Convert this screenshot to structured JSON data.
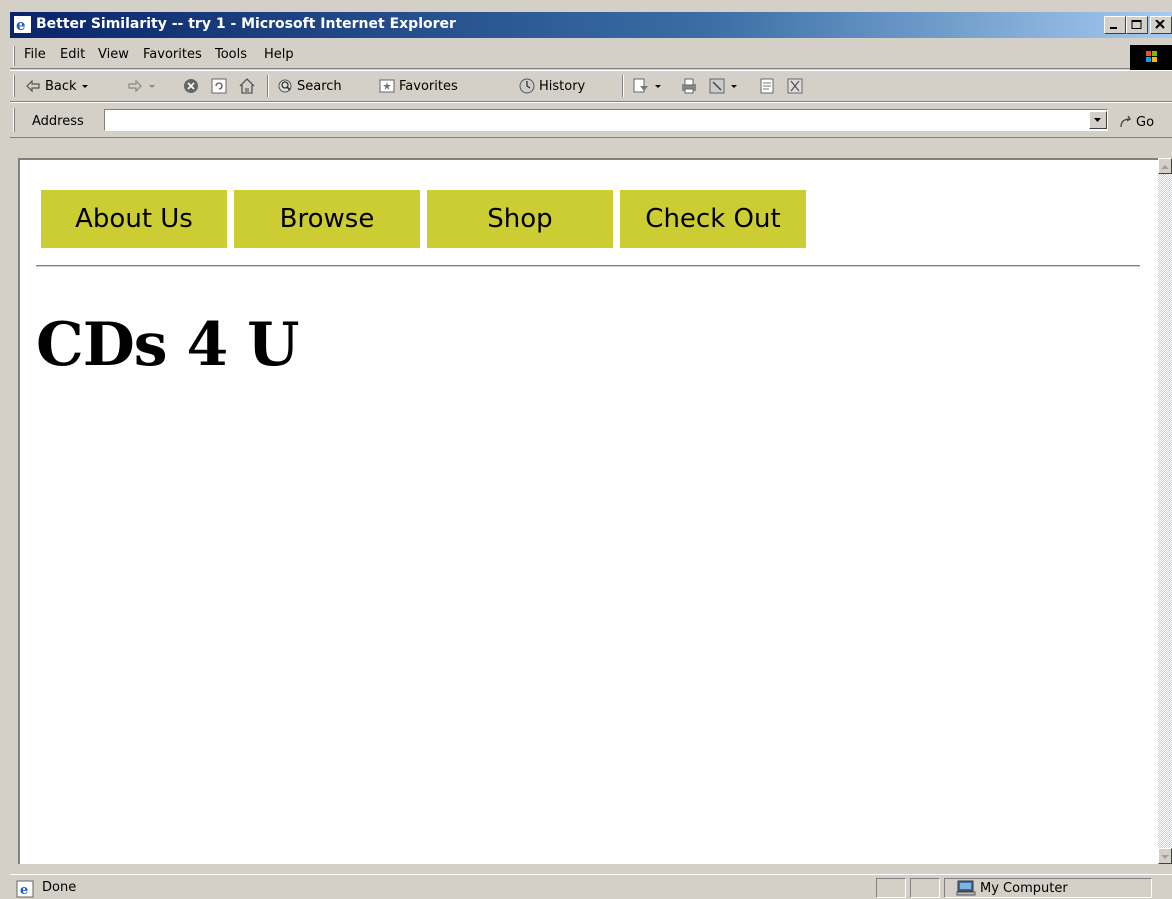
{
  "window": {
    "title": "Better Similarity -- try 1 - Microsoft Internet Explorer",
    "controls": [
      "minimize-icon",
      "maximize-icon",
      "close-icon"
    ]
  },
  "menu": {
    "file": "File",
    "edit": "Edit",
    "view": "View",
    "favorites": "Favorites",
    "tools": "Tools",
    "help": "Help"
  },
  "toolbar": {
    "back": "Back",
    "search": "Search",
    "favorites": "Favorites",
    "history": "History"
  },
  "address": {
    "label": "Address",
    "value": "",
    "go": "Go"
  },
  "page": {
    "nav": [
      "About Us",
      "Browse",
      "Shop",
      "Check Out"
    ],
    "heading": "CDs 4 U",
    "nav_color": "#cccc33"
  },
  "status": {
    "text": "Done",
    "zone": "My Computer"
  }
}
